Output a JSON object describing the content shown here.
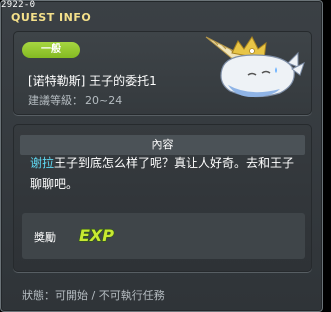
{
  "window": {
    "quest_id": "2922-0",
    "title": "QUEST INFO"
  },
  "header": {
    "category": "一般",
    "quest_name": "[诺特勒斯] 王子的委托1",
    "level_label": "建議等級：",
    "level_value": "20~24"
  },
  "content": {
    "section_title": "內容",
    "npc_name": "谢拉",
    "description_line1_rest": "王子到底怎么样了呢？真让人好奇。去和王子",
    "description_line2": "聊聊吧。",
    "reward_label": "獎勵",
    "reward_type": "EXP"
  },
  "status": {
    "text": "狀態：可開始 / 不可執行任務"
  },
  "colors": {
    "badge": "#9ccd39",
    "npc": "#5fd7f0",
    "title": "#f4e08a",
    "exp": "#c8e832"
  }
}
